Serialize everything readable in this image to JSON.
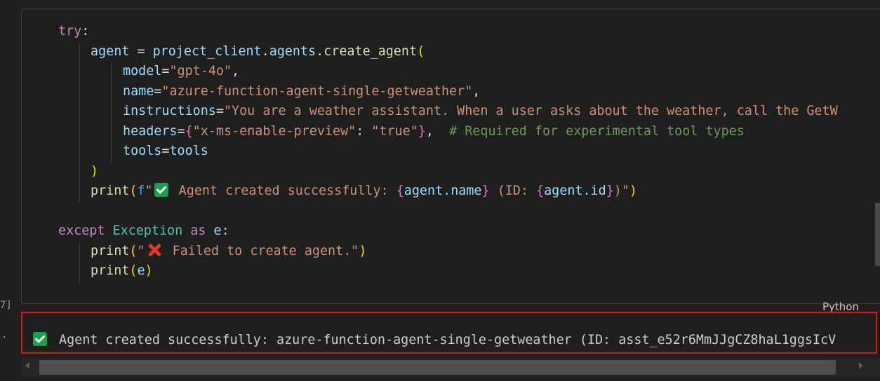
{
  "cell": {
    "language": "Python",
    "execution_count_fragment": "7]",
    "output_marker": "·"
  },
  "code": {
    "l1": {
      "kw_try": "try",
      "colon": ":"
    },
    "l2": {
      "var_agent": "agent",
      "eq": " = ",
      "obj": "project_client",
      "dot1": ".",
      "attr": "agents",
      "dot2": ".",
      "fn": "create_agent",
      "paren": "("
    },
    "l3": {
      "param": "model",
      "eq": "=",
      "val": "\"gpt-4o\"",
      "comma": ","
    },
    "l4": {
      "param": "name",
      "eq": "=",
      "val": "\"azure-function-agent-single-getweather\"",
      "comma": ","
    },
    "l5": {
      "param": "instructions",
      "eq": "=",
      "val": "\"You are a weather assistant. When a user asks about the weather, call the GetW"
    },
    "l6": {
      "param": "headers",
      "eq": "=",
      "brace_open": "{",
      "key": "\"x-ms-enable-preview\"",
      "colon": ": ",
      "val": "\"true\"",
      "brace_close": "}",
      "comma": ",  ",
      "comment": "# Required for experimental tool types"
    },
    "l7": {
      "param": "tools",
      "eq": "=",
      "val": "tools"
    },
    "l8": {
      "paren": ")"
    },
    "l9": {
      "fn": "print",
      "paren_open": "(",
      "prefix": "f",
      "str_open": "\"",
      "str1": " Agent created successfully: ",
      "b1o": "{",
      "expr1": "agent.name",
      "b1c": "}",
      "str2": " (ID: ",
      "b2o": "{",
      "expr2": "agent.id",
      "b2c": "}",
      "str3": ")\"",
      "paren_close": ")"
    },
    "l10": {
      "kw": "except",
      "cls": "Exception",
      "as": "as",
      "var": "e",
      "colon": ":"
    },
    "l11": {
      "fn": "print",
      "paren_open": "(",
      "str_open": "\"",
      "str": " Failed to create agent.\"",
      "paren_close": ")"
    },
    "l12": {
      "fn": "print",
      "paren_open": "(",
      "var": "e",
      "paren_close": ")"
    }
  },
  "output": {
    "icon": "check-mark-icon",
    "text": "Agent created successfully: azure-function-agent-single-getweather (ID: asst_e52r6MmJJgCZ8haL1ggsIcV"
  },
  "colors": {
    "keyword": "#c586c0",
    "variable": "#9cdcfe",
    "function": "#dcdcaa",
    "string": "#ce9178",
    "class": "#4ec9b0",
    "comment": "#6a9955",
    "highlight_border": "#d11a1a"
  }
}
